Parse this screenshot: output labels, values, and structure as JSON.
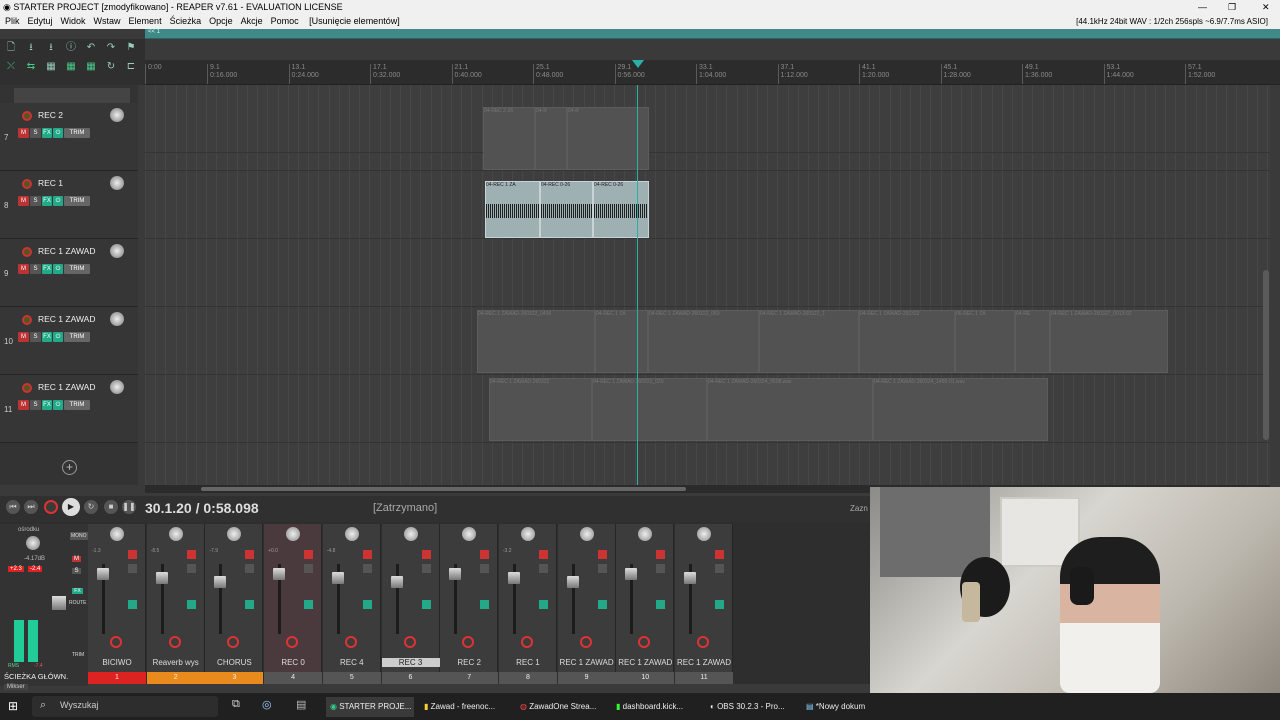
{
  "window": {
    "title": "STARTER PROJECT [zmodyfikowano] - REAPER v7.61 - EVALUATION LICENSE",
    "audio_info": "[44.1kHz 24bit WAV : 1/2ch 256spls ~6.9/7.7ms ASIO]"
  },
  "menu": [
    "Plik",
    "Edytuj",
    "Widok",
    "Wstaw",
    "Element",
    "Ścieżka",
    "Opcje",
    "Akcje",
    "Pomoc"
  ],
  "undo_hint": "[Usunięcie elementów]",
  "teal_label": "<< 1",
  "ruler": [
    {
      "bar": "9.1",
      "time": "0:16.000"
    },
    {
      "bar": "13.1",
      "time": "0:24.000"
    },
    {
      "bar": "17.1",
      "time": "0:32.000"
    },
    {
      "bar": "21.1",
      "time": "0:40.000"
    },
    {
      "bar": "25.1",
      "time": "0:48.000"
    },
    {
      "bar": "29.1",
      "time": "0:56.000"
    },
    {
      "bar": "33.1",
      "time": "1:04.000"
    },
    {
      "bar": "37.1",
      "time": "1:12.000"
    },
    {
      "bar": "41.1",
      "time": "1:20.000"
    },
    {
      "bar": "45.1",
      "time": "1:28.000"
    },
    {
      "bar": "49.1",
      "time": "1:36.000"
    },
    {
      "bar": "53.1",
      "time": "1:44.000"
    },
    {
      "bar": "57.1",
      "time": "1:52.000"
    }
  ],
  "ruler_start": "0:00",
  "tracks": [
    {
      "num": "7",
      "name": "REC 2"
    },
    {
      "num": "8",
      "name": "REC 1"
    },
    {
      "num": "9",
      "name": "REC 1 ZAWAD"
    },
    {
      "num": "10",
      "name": "REC 1 ZAWAD"
    },
    {
      "num": "11",
      "name": "REC 1 ZAWAD"
    }
  ],
  "track_buttons": {
    "m": "M",
    "s": "S",
    "fx": "FX",
    "trim": "TRIM"
  },
  "items": {
    "rec2": [
      "04-REC 2-26",
      "04-R",
      "04-R"
    ],
    "rec1": [
      "04-REC 1 ZA",
      "04-REC 0-26",
      "04-REC 0-26"
    ],
    "zawad10": [
      "04-REC 1 ZAWAD-260322_0456",
      "04-REC 1 ZA",
      "04-REC 1 ZAWAD-260322_060",
      "04-REC 1 ZAWAD-260322_1",
      "04-REC 1 ZAWAD-260322",
      "05-REC 1 ZA",
      "04-RE",
      "04-REC 1 ZAWAD-260327_0013-02"
    ],
    "zawad11": [
      "04-REC 1 ZAWAD-260322",
      "04-REC 1 ZAWAD-260322_020",
      "04-REC 1 ZAWAD-260324_0508.wav",
      "04-REC 1 ZAWAD-260324_1455-01.wav"
    ]
  },
  "transport": {
    "time": "30.1.20 / 0:58.098",
    "status": "[Zatrzymano]",
    "zazn": "Zazn"
  },
  "master": {
    "name": "ŚCIEŻKA GŁÓWN.",
    "label_top": "ośrodku",
    "db": "-4.17dB",
    "peak_l": "+2.3",
    "peak_r": "-2.4",
    "rms": "RMS",
    "rms_val": "-7.4",
    "buttons": [
      "MONO",
      "M",
      "S",
      "FX",
      "ROUTE",
      "TRIM"
    ]
  },
  "strips": [
    {
      "name": "BICIWO",
      "idx": "1",
      "db": "-1.3",
      "color": "#d22"
    },
    {
      "name": "Reaverb wys",
      "idx": "2",
      "db": "-8.5",
      "color": "#e88a1c"
    },
    {
      "name": "CHORUS",
      "idx": "3",
      "db": "-7.9",
      "color": "#e88a1c"
    },
    {
      "name": "REC 0",
      "idx": "4",
      "db": "+0.0",
      "color": "#555"
    },
    {
      "name": "REC 4",
      "idx": "5",
      "db": "-4.8",
      "color": "#555"
    },
    {
      "name": "REC 3",
      "idx": "6",
      "db": "",
      "color": "#555"
    },
    {
      "name": "REC 2",
      "idx": "7",
      "db": "",
      "color": "#555"
    },
    {
      "name": "REC 1",
      "idx": "8",
      "db": "-3.2",
      "color": "#555"
    },
    {
      "name": "REC 1 ZAWAD",
      "idx": "9",
      "db": "",
      "color": "#555"
    },
    {
      "name": "REC 1 ZAWAD",
      "idx": "10",
      "db": "",
      "color": "#555"
    },
    {
      "name": "REC 1 ZAWAD",
      "idx": "11",
      "db": "",
      "color": "#555"
    }
  ],
  "mikser_tab": "Mikser",
  "taskbar": {
    "search": "Wyszukaj",
    "apps": [
      "STARTER PROJE...",
      "Zawad - freenoc...",
      "ZawadOne Strea...",
      "dashboard.kick...",
      "OBS 30.2.3 - Pro...",
      "*Nowy dokum"
    ]
  },
  "colors": {
    "teal": "#3f8a88",
    "rec": "#cc3333",
    "fx": "#22aa88"
  }
}
